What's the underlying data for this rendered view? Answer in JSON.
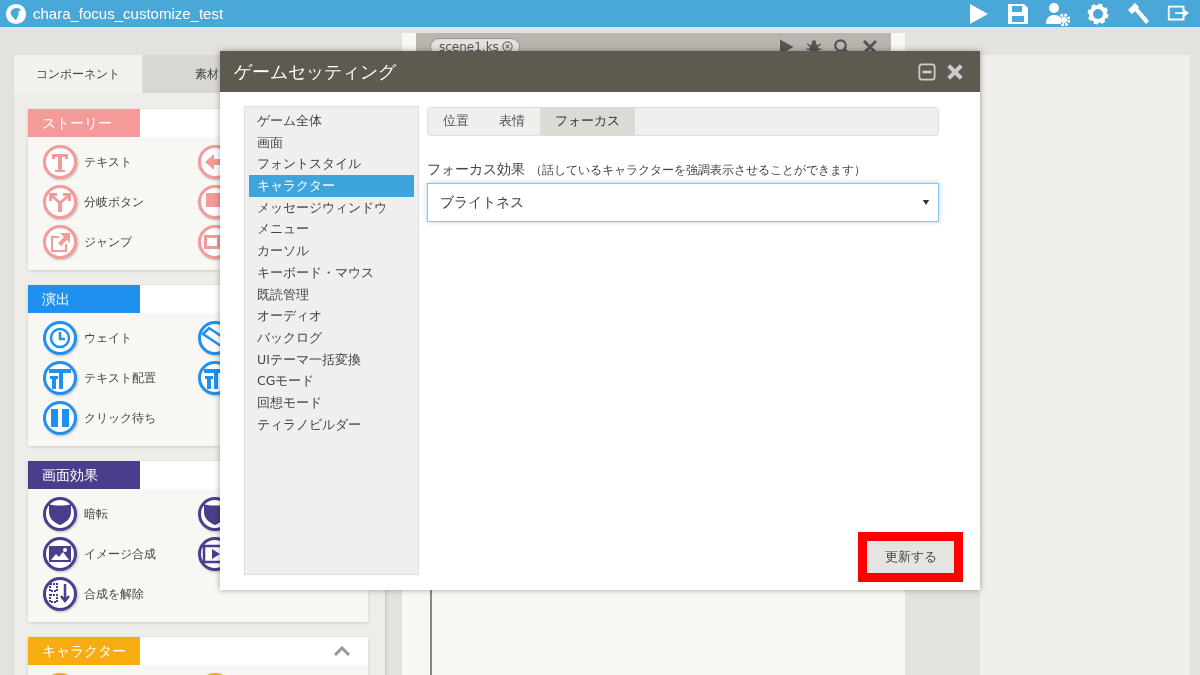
{
  "app_bar": {
    "title": "chara_focus_customize_test",
    "actions": [
      {
        "kind": "play"
      },
      {
        "kind": "save"
      },
      {
        "kind": "user-gear"
      },
      {
        "kind": "gear"
      },
      {
        "kind": "hammer"
      },
      {
        "kind": "exit"
      }
    ]
  },
  "left_panel": {
    "tabs": [
      {
        "label": "コンポーネント",
        "selected": true
      },
      {
        "label": "素材",
        "selected": false
      }
    ],
    "sections": [
      {
        "title": "ストーリー",
        "color": "#f49a98",
        "items": [
          {
            "label": "テキスト",
            "kind": "text"
          },
          {
            "kind": "back"
          },
          {
            "label": "分岐ボタン",
            "kind": "branch"
          },
          {
            "kind": "flag"
          },
          {
            "label": "ジャンプ",
            "kind": "jump"
          },
          {
            "kind": "window"
          }
        ]
      },
      {
        "title": "演出",
        "color": "#1e90f0",
        "items": [
          {
            "label": "ウェイト",
            "kind": "clock"
          },
          {
            "kind": "tilt"
          },
          {
            "label": "テキスト配置",
            "kind": "textpos"
          },
          {
            "kind": "textpos"
          },
          {
            "label": "クリック待ち",
            "kind": "pause"
          }
        ]
      },
      {
        "title": "画面効果",
        "color": "#4a3d8c",
        "items": [
          {
            "label": "暗転",
            "kind": "shield"
          },
          {
            "kind": "shield"
          },
          {
            "label": "イメージ合成",
            "kind": "image"
          },
          {
            "kind": "film"
          },
          {
            "label": "合成を解除",
            "kind": "unmerge"
          }
        ]
      },
      {
        "title": "キャラクター",
        "color": "#f7ad10",
        "expanded": true,
        "items": [
          {
            "kind": "plain"
          },
          {
            "kind": "plain"
          }
        ]
      }
    ]
  },
  "editor": {
    "tab": "scene1.ks",
    "actions": [
      {
        "kind": "play"
      },
      {
        "kind": "bug"
      },
      {
        "kind": "search"
      },
      {
        "kind": "close"
      }
    ]
  },
  "dialog": {
    "title": "ゲームセッティング",
    "menu": [
      {
        "label": "ゲーム全体",
        "selected": false
      },
      {
        "label": "画面",
        "selected": false
      },
      {
        "label": "フォントスタイル",
        "selected": false
      },
      {
        "label": "キャラクター",
        "selected": true
      },
      {
        "label": "メッセージウィンドウ",
        "selected": false
      },
      {
        "label": "メニュー",
        "selected": false
      },
      {
        "label": "カーソル",
        "selected": false
      },
      {
        "label": "キーボード・マウス",
        "selected": false
      },
      {
        "label": "既読管理",
        "selected": false
      },
      {
        "label": "オーディオ",
        "selected": false
      },
      {
        "label": "バックログ",
        "selected": false
      },
      {
        "label": "UIテーマ一括変換",
        "selected": false
      },
      {
        "label": "CGモード",
        "selected": false
      },
      {
        "label": "回想モード",
        "selected": false
      },
      {
        "label": "ティラノビルダー",
        "selected": false
      }
    ],
    "tabs": [
      {
        "label": "位置",
        "selected": false
      },
      {
        "label": "表情",
        "selected": false
      },
      {
        "label": "フォーカス",
        "selected": true
      }
    ],
    "field": {
      "label": "フォーカス効果",
      "hint": "（話しているキャラクターを強調表示させることができます）",
      "value": "ブライトネス"
    },
    "button": {
      "label": "更新する",
      "highlighted": true
    }
  }
}
